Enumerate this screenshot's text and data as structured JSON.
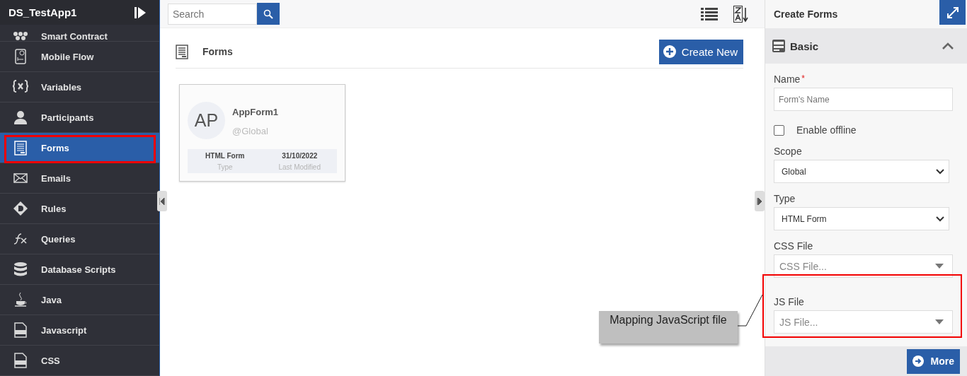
{
  "app": {
    "title": "DS_TestApp1"
  },
  "sidebar": {
    "items": [
      {
        "label": "Smart Contract",
        "selected": false,
        "partial": true
      },
      {
        "label": "Mobile Flow",
        "selected": false
      },
      {
        "label": "Variables",
        "selected": false
      },
      {
        "label": "Participants",
        "selected": false
      },
      {
        "label": "Forms",
        "selected": true
      },
      {
        "label": "Emails",
        "selected": false
      },
      {
        "label": "Rules",
        "selected": false
      },
      {
        "label": "Queries",
        "selected": false
      },
      {
        "label": "Database Scripts",
        "selected": false
      },
      {
        "label": "Java",
        "selected": false
      },
      {
        "label": "Javascript",
        "selected": false
      },
      {
        "label": "CSS",
        "selected": false
      }
    ]
  },
  "toolbar": {
    "search": {
      "placeholder": "Search"
    }
  },
  "content": {
    "title": "Forms",
    "create_button": "Create New",
    "cards": [
      {
        "initials": "AP",
        "name": "AppForm1",
        "scope": "@Global",
        "type": "HTML Form",
        "type_label": "Type",
        "modified": "31/10/2022",
        "modified_label": "Last Modified"
      }
    ]
  },
  "panel": {
    "title": "Create Forms",
    "section": {
      "title": "Basic",
      "expanded": true
    },
    "fields": [
      {
        "kind": "text",
        "label": "Name",
        "required_mark": "*",
        "placeholder": "Form's Name"
      },
      {
        "kind": "checkbox",
        "label": "Enable offline",
        "checked": false
      },
      {
        "kind": "select",
        "label": "Scope",
        "value": "Global"
      },
      {
        "kind": "select",
        "label": "Type",
        "value": "HTML Form"
      },
      {
        "kind": "combo",
        "label": "CSS File",
        "placeholder": "CSS File..."
      },
      {
        "kind": "combo",
        "label": "JS File",
        "placeholder": "JS File...",
        "highlighted": true
      }
    ],
    "more_button": "More"
  },
  "annotation": {
    "callout": "Mapping JavaScript file"
  }
}
